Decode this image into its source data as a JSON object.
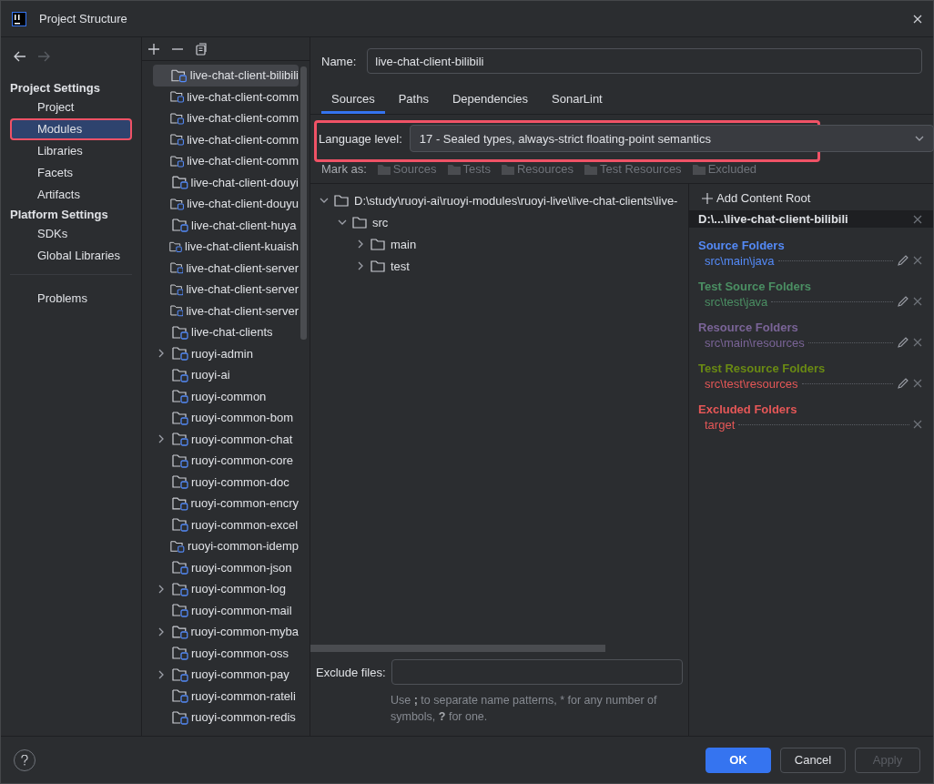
{
  "window": {
    "title": "Project Structure"
  },
  "sidebar": {
    "sections": [
      {
        "title": "Project Settings",
        "items": [
          {
            "label": "Project",
            "selected": false,
            "highlighted": false
          },
          {
            "label": "Modules",
            "selected": true,
            "highlighted": true
          },
          {
            "label": "Libraries",
            "selected": false,
            "highlighted": false
          },
          {
            "label": "Facets",
            "selected": false,
            "highlighted": false
          },
          {
            "label": "Artifacts",
            "selected": false,
            "highlighted": false
          }
        ]
      },
      {
        "title": "Platform Settings",
        "items": [
          {
            "label": "SDKs",
            "selected": false,
            "highlighted": false
          },
          {
            "label": "Global Libraries",
            "selected": false,
            "highlighted": false
          }
        ]
      }
    ],
    "extra_items": [
      {
        "label": "Problems",
        "selected": false,
        "highlighted": false
      }
    ]
  },
  "modules": [
    {
      "name": "live-chat-client-bilibili",
      "selected": true,
      "expandable": false
    },
    {
      "name": "live-chat-client-comm",
      "selected": false,
      "expandable": false
    },
    {
      "name": "live-chat-client-comm",
      "selected": false,
      "expandable": false
    },
    {
      "name": "live-chat-client-comm",
      "selected": false,
      "expandable": false
    },
    {
      "name": "live-chat-client-comm",
      "selected": false,
      "expandable": false
    },
    {
      "name": "live-chat-client-douyi",
      "selected": false,
      "expandable": false
    },
    {
      "name": "live-chat-client-douyu",
      "selected": false,
      "expandable": false
    },
    {
      "name": "live-chat-client-huya",
      "selected": false,
      "expandable": false
    },
    {
      "name": "live-chat-client-kuaish",
      "selected": false,
      "expandable": false
    },
    {
      "name": "live-chat-client-server",
      "selected": false,
      "expandable": false
    },
    {
      "name": "live-chat-client-server",
      "selected": false,
      "expandable": false
    },
    {
      "name": "live-chat-client-server",
      "selected": false,
      "expandable": false
    },
    {
      "name": "live-chat-clients",
      "selected": false,
      "expandable": false
    },
    {
      "name": "ruoyi-admin",
      "selected": false,
      "expandable": true
    },
    {
      "name": "ruoyi-ai",
      "selected": false,
      "expandable": false
    },
    {
      "name": "ruoyi-common",
      "selected": false,
      "expandable": false
    },
    {
      "name": "ruoyi-common-bom",
      "selected": false,
      "expandable": false
    },
    {
      "name": "ruoyi-common-chat",
      "selected": false,
      "expandable": true
    },
    {
      "name": "ruoyi-common-core",
      "selected": false,
      "expandable": false
    },
    {
      "name": "ruoyi-common-doc",
      "selected": false,
      "expandable": false
    },
    {
      "name": "ruoyi-common-encry",
      "selected": false,
      "expandable": false
    },
    {
      "name": "ruoyi-common-excel",
      "selected": false,
      "expandable": false
    },
    {
      "name": "ruoyi-common-idemp",
      "selected": false,
      "expandable": false
    },
    {
      "name": "ruoyi-common-json",
      "selected": false,
      "expandable": false
    },
    {
      "name": "ruoyi-common-log",
      "selected": false,
      "expandable": true
    },
    {
      "name": "ruoyi-common-mail",
      "selected": false,
      "expandable": false
    },
    {
      "name": "ruoyi-common-myba",
      "selected": false,
      "expandable": true
    },
    {
      "name": "ruoyi-common-oss",
      "selected": false,
      "expandable": false
    },
    {
      "name": "ruoyi-common-pay",
      "selected": false,
      "expandable": true
    },
    {
      "name": "ruoyi-common-rateli",
      "selected": false,
      "expandable": false
    },
    {
      "name": "ruoyi-common-redis",
      "selected": false,
      "expandable": false
    }
  ],
  "name_field": {
    "label": "Name:",
    "value": "live-chat-client-bilibili"
  },
  "tabs": [
    {
      "label": "Sources",
      "selected": true
    },
    {
      "label": "Paths",
      "selected": false
    },
    {
      "label": "Dependencies",
      "selected": false
    },
    {
      "label": "SonarLint",
      "selected": false
    }
  ],
  "language_level": {
    "label": "Language level:",
    "value": "17 - Sealed types, always-strict floating-point semantics",
    "highlighted": true
  },
  "mark_as": {
    "label": "Mark as:",
    "buttons": [
      {
        "label": "Sources",
        "disabled": true
      },
      {
        "label": "Tests",
        "disabled": true
      },
      {
        "label": "Resources",
        "disabled": true
      },
      {
        "label": "Test Resources",
        "disabled": true
      },
      {
        "label": "Excluded",
        "disabled": true
      }
    ]
  },
  "tree": [
    {
      "label": "D:\\study\\ruoyi-ai\\ruoyi-modules\\ruoyi-live\\live-chat-clients\\live-",
      "expanded": true,
      "children": [
        {
          "label": "src",
          "expanded": true,
          "children": [
            {
              "label": "main",
              "expanded": false
            },
            {
              "label": "test",
              "expanded": false
            }
          ]
        }
      ]
    }
  ],
  "exclude_files": {
    "label": "Exclude files:",
    "hint": [
      {
        "text": "Use ",
        "bold": false
      },
      {
        "text": ";",
        "bold": true
      },
      {
        "text": " to separate name patterns, * for any number of symbols, ",
        "bold": false
      },
      {
        "text": "?",
        "bold": true
      },
      {
        "text": " for one.",
        "bold": false
      }
    ]
  },
  "content_root": {
    "add_label": "Add Content Root",
    "path": "D:\\...\\live-chat-client-bilibili",
    "groups": [
      {
        "title": "Source Folders",
        "color": "#548af7",
        "folders": [
          {
            "path": "src\\main\\java",
            "color": "#548af7",
            "editable": true
          }
        ]
      },
      {
        "title": "Test Source Folders",
        "color": "#4b8f63",
        "folders": [
          {
            "path": "src\\test\\java",
            "color": "#4b8f63",
            "editable": true
          }
        ]
      },
      {
        "title": "Resource Folders",
        "color": "#7a6497",
        "folders": [
          {
            "path": "src\\main\\resources",
            "color": "#7a6497",
            "editable": true
          }
        ]
      },
      {
        "title": "Test Resource Folders",
        "color": "#6a8a13",
        "folders": [
          {
            "path": "src\\test\\resources",
            "color": "#e55757",
            "editable": true
          }
        ]
      },
      {
        "title": "Excluded Folders",
        "color": "#e55757",
        "folders": [
          {
            "path": "target",
            "color": "#e55757",
            "editable": false
          }
        ]
      }
    ]
  },
  "buttons": [
    {
      "label": "OK",
      "kind": "primary",
      "disabled": false
    },
    {
      "label": "Cancel",
      "kind": "normal",
      "disabled": false
    },
    {
      "label": "Apply",
      "kind": "normal",
      "disabled": true
    }
  ]
}
